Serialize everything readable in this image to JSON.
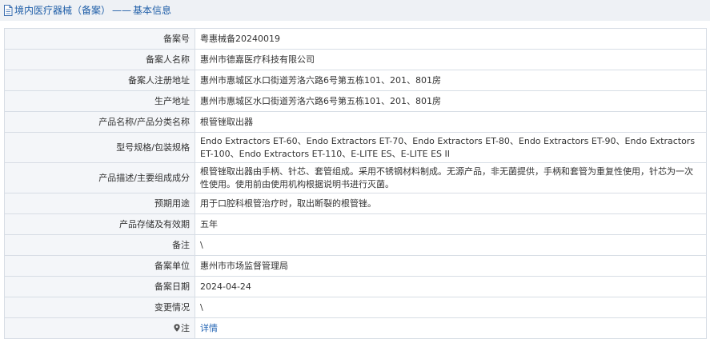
{
  "breadcrumb": {
    "section": "境内医疗器械（备案）",
    "separator": "——",
    "page": "基本信息"
  },
  "rows": [
    {
      "key": "record_no",
      "label": "备案号",
      "value": "粤惠械备20240019"
    },
    {
      "key": "filer_name",
      "label": "备案人名称",
      "value": "惠州市德嘉医疗科技有限公司"
    },
    {
      "key": "reg_address",
      "label": "备案人注册地址",
      "value": "惠州市惠城区水口街道芳洛六路6号第五栋101、201、801房"
    },
    {
      "key": "prod_address",
      "label": "生产地址",
      "value": "惠州市惠城区水口街道芳洛六路6号第五栋101、201、801房"
    },
    {
      "key": "product_name",
      "label": "产品名称/产品分类名称",
      "value": "根管锉取出器"
    },
    {
      "key": "model_spec",
      "label": "型号规格/包装规格",
      "value": "Endo Extractors ET-60、Endo Extractors ET-70、Endo Extractors ET-80、Endo Extractors ET-90、Endo Extractors ET-100、Endo Extractors ET-110、E-LITE ES、E-LITE ES II"
    },
    {
      "key": "description",
      "label": "产品描述/主要组成成分",
      "value": "根管锉取出器由手柄、针芯、套管组成。采用不锈钢材料制成。无源产品，非无菌提供，手柄和套管为重复性使用，针芯为一次性使用。使用前由使用机构根据说明书进行灭菌。"
    },
    {
      "key": "intended_use",
      "label": "预期用途",
      "value": "用于口腔科根管治疗时，取出断裂的根管锉。"
    },
    {
      "key": "storage",
      "label": "产品存储及有效期",
      "value": "五年"
    },
    {
      "key": "remark",
      "label": "备注",
      "value": "\\"
    },
    {
      "key": "unit",
      "label": "备案单位",
      "value": "惠州市市场监督管理局"
    },
    {
      "key": "date",
      "label": "备案日期",
      "value": "2024-04-24"
    },
    {
      "key": "change",
      "label": "变更情况",
      "value": "\\"
    }
  ],
  "note_row": {
    "label": "注",
    "link_text": "详情",
    "icon": "map-pin-icon"
  },
  "colors": {
    "link": "#2566b4",
    "border": "#d7dde5",
    "label_bg": "#f4f6f9",
    "topbar_bg": "#eef1f5"
  }
}
